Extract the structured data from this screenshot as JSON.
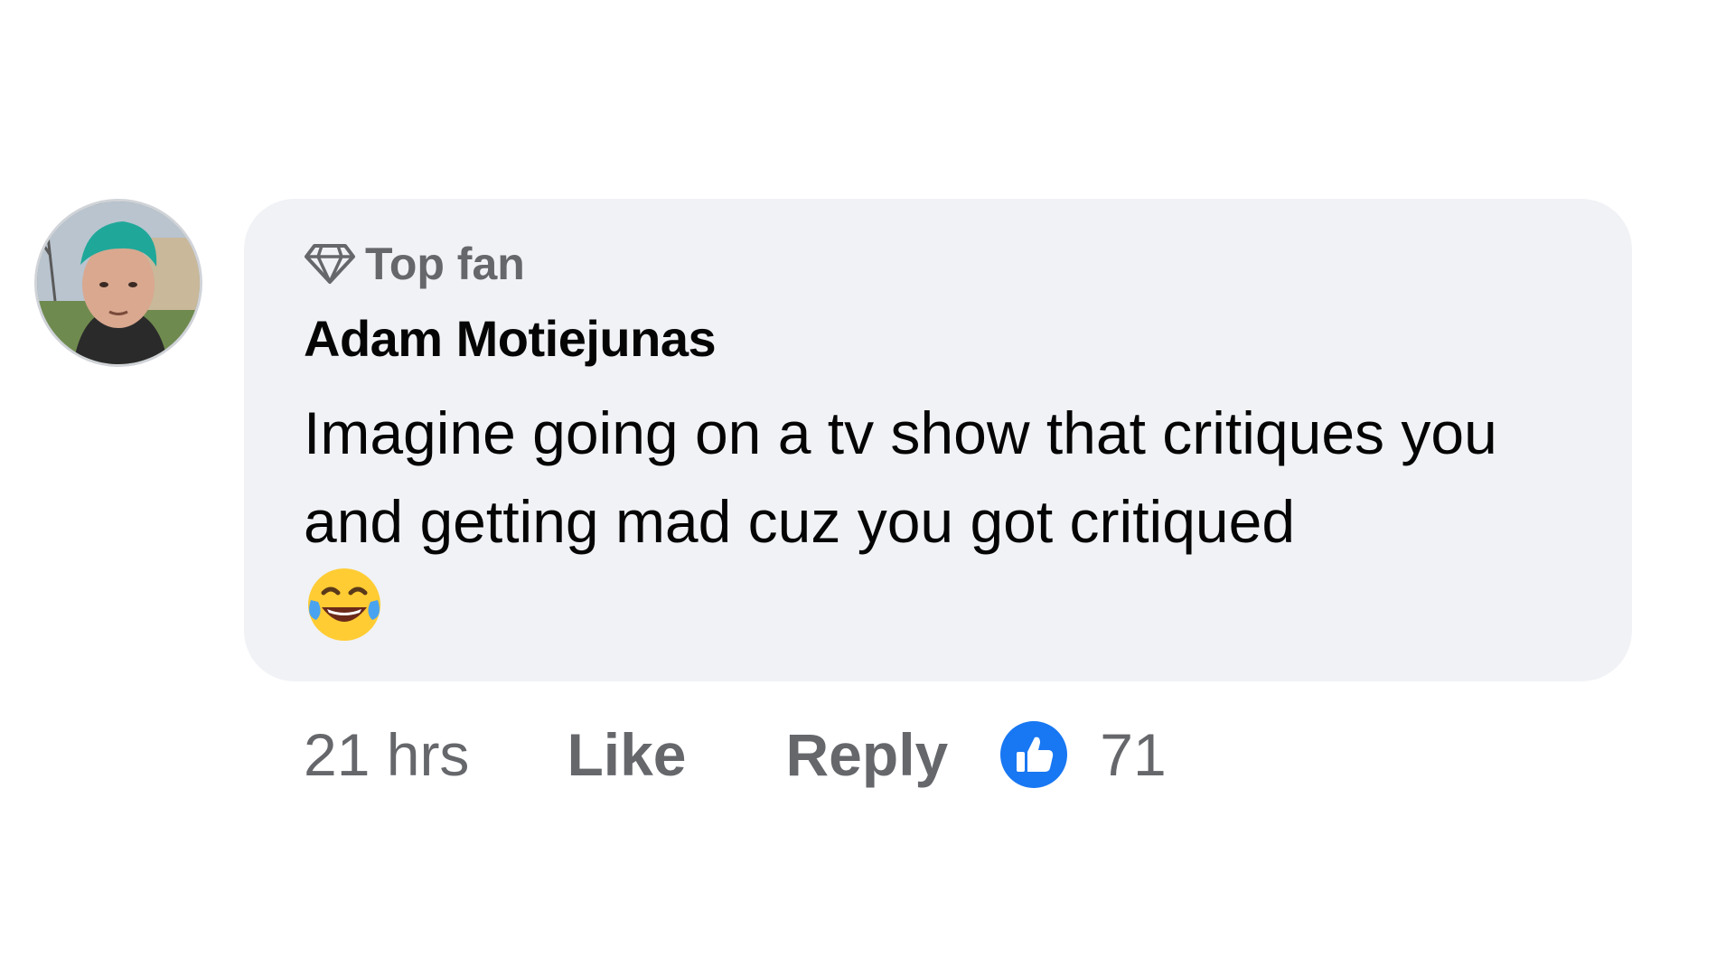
{
  "comment": {
    "badge": {
      "icon": "diamond-icon",
      "label": "Top fan"
    },
    "author": "Adam Motiejunas",
    "text": "Imagine going on a tv show that critiques you and getting mad cuz you got critiqued",
    "emoji": "face-with-tears-of-joy-icon",
    "timestamp": "21 hrs",
    "actions": {
      "like_label": "Like",
      "reply_label": "Reply"
    },
    "reactions": {
      "icon": "thumbs-up-icon",
      "count": "71"
    }
  },
  "colors": {
    "bubble_background": "#f0f2f5",
    "secondary_text": "#65676b",
    "primary_text": "#050505",
    "like_blue": "#1877f2"
  }
}
